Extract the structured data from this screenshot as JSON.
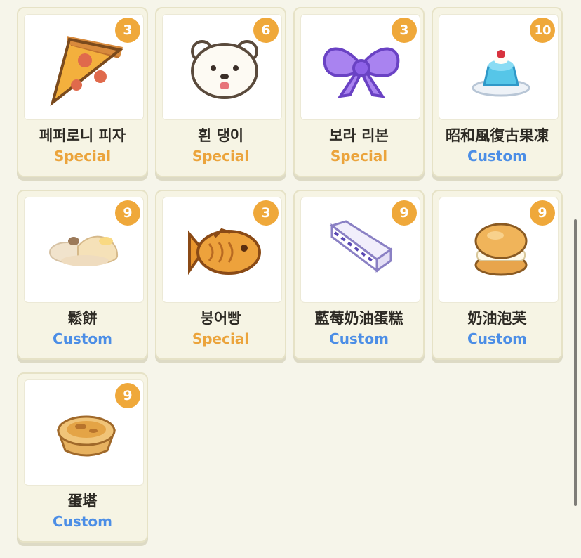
{
  "items": [
    {
      "name": "페퍼로니 피자",
      "count": "3",
      "tag": "Special",
      "icon": "pepperoni-pizza-icon"
    },
    {
      "name": "흰 댕이",
      "count": "6",
      "tag": "Special",
      "icon": "white-puppy-icon"
    },
    {
      "name": "보라 리본",
      "count": "3",
      "tag": "Special",
      "icon": "purple-ribbon-icon"
    },
    {
      "name": "昭和風復古果凍",
      "count": "10",
      "tag": "Custom",
      "icon": "retro-jelly-icon"
    },
    {
      "name": "鬆餅",
      "count": "9",
      "tag": "Custom",
      "icon": "pancake-icon"
    },
    {
      "name": "붕어빵",
      "count": "3",
      "tag": "Special",
      "icon": "fish-bread-icon"
    },
    {
      "name": "藍莓奶油蛋糕",
      "count": "9",
      "tag": "Custom",
      "icon": "blueberry-cream-cake-icon"
    },
    {
      "name": "奶油泡芙",
      "count": "9",
      "tag": "Custom",
      "icon": "cream-puff-icon"
    },
    {
      "name": "蛋塔",
      "count": "9",
      "tag": "Custom",
      "icon": "egg-tart-icon"
    }
  ],
  "colors": {
    "special": "#eba43c",
    "custom": "#4c8ee6",
    "badge": "#efa83a"
  }
}
